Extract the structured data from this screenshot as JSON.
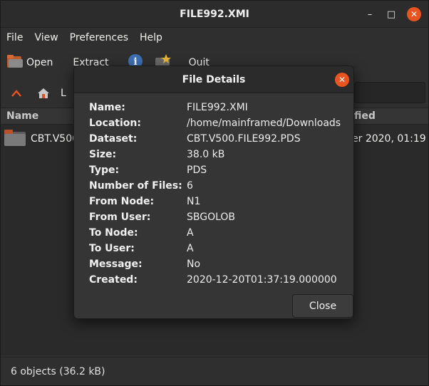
{
  "window": {
    "title": "FILE992.XMI",
    "controls": {
      "minimize": "–",
      "maximize": "□",
      "close": "✕"
    }
  },
  "menubar": [
    "File",
    "View",
    "Preferences",
    "Help"
  ],
  "toolbar": {
    "open_label": "Open",
    "extract_label": "Extract",
    "quit_label": "Quit"
  },
  "navbar": {
    "location_label_partial": "L"
  },
  "file_list": {
    "columns": {
      "name": "Name",
      "modified_partial": "fied"
    },
    "rows": [
      {
        "name": "CBT.V500",
        "modified": "er 2020, 01:19"
      }
    ]
  },
  "statusbar": {
    "text": "6 objects (36.2 kB)"
  },
  "dialog": {
    "title": "File Details",
    "close_label": "Close",
    "details": [
      {
        "label": "Name:",
        "value": "FILE992.XMI"
      },
      {
        "label": "Location:",
        "value": "/home/mainframed/Downloads"
      },
      {
        "label": "Dataset:",
        "value": "CBT.V500.FILE992.PDS"
      },
      {
        "label": "Size:",
        "value": "38.0 kB"
      },
      {
        "label": "Type:",
        "value": "PDS"
      },
      {
        "label": "Number of Files:",
        "value": "6"
      },
      {
        "label": "From Node:",
        "value": "N1"
      },
      {
        "label": "From User:",
        "value": "SBGOLOB"
      },
      {
        "label": "To Node:",
        "value": "A"
      },
      {
        "label": "To User:",
        "value": "A"
      },
      {
        "label": "Message:",
        "value": "No"
      },
      {
        "label": "Created:",
        "value": "2020-12-20T01:37:19.000000"
      }
    ]
  },
  "colors": {
    "accent": "#e95420",
    "folder": "#7a7a7a",
    "info_icon": "#3d6fb5"
  },
  "icons": {
    "open": "folder-open-icon",
    "info": "info-icon",
    "quit": "quit-icon",
    "up": "up-arrow-icon",
    "home": "home-icon",
    "folder": "folder-icon"
  }
}
